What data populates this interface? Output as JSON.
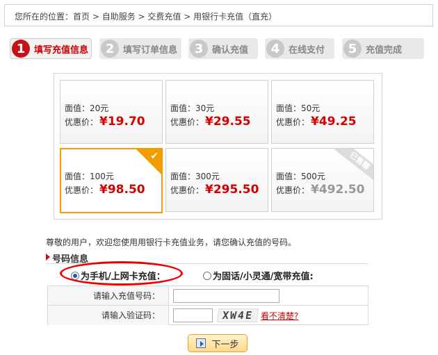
{
  "breadcrumb": {
    "prefix": "您所在的位置：",
    "items": [
      "首页",
      "自助服务",
      "交费充值",
      "用银行卡充值（直充）"
    ],
    "separator": " > "
  },
  "steps": [
    {
      "num": "1",
      "label": "填写充值信息",
      "active": true
    },
    {
      "num": "2",
      "label": "填写订单信息",
      "active": false
    },
    {
      "num": "3",
      "label": "确认充值",
      "active": false
    },
    {
      "num": "4",
      "label": "在线支付",
      "active": false
    },
    {
      "num": "5",
      "label": "充值完成",
      "active": false
    }
  ],
  "cards": [
    {
      "face": "面值：20元",
      "price_label": "优惠价：",
      "price": "¥19.70",
      "state": "normal"
    },
    {
      "face": "面值：30元",
      "price_label": "优惠价：",
      "price": "¥29.55",
      "state": "normal"
    },
    {
      "face": "面值：50元",
      "price_label": "优惠价：",
      "price": "¥49.25",
      "state": "normal"
    },
    {
      "face": "面值：100元",
      "price_label": "优惠价：",
      "price": "¥98.50",
      "state": "selected"
    },
    {
      "face": "面值：300元",
      "price_label": "优惠价：",
      "price": "¥295.50",
      "state": "normal"
    },
    {
      "face": "面值：500元",
      "price_label": "优惠价：",
      "price": "¥492.50",
      "state": "soldout",
      "badge": "已售罄"
    }
  ],
  "notice": "尊敬的用户，欢迎您使用用银行卡充值业务，请您确认充值的号码。",
  "section_title": "号码信息",
  "radio": {
    "option1": "为手机/上网卡充值：",
    "option2": "为固话/小灵通/宽带充值:",
    "selected": "option1"
  },
  "form": {
    "number_label": "请输入充值号码：",
    "number_value": "",
    "captcha_label": "请输入验证码：",
    "captcha_value": "",
    "captcha_text": "XW4E",
    "unclear_link": "看不清楚?"
  },
  "next_button": "下一步",
  "colors": {
    "accent": "#c8101a",
    "price": "#d40000",
    "selected_border": "#f29c00"
  },
  "icons": [
    "checkmark-icon",
    "next-arrow-icon"
  ]
}
